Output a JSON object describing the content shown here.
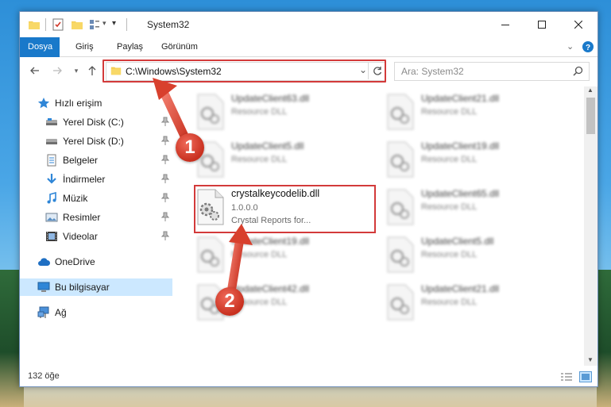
{
  "window": {
    "title": "System32"
  },
  "ribbon": {
    "tabs": [
      "Dosya",
      "Giriş",
      "Paylaş",
      "Görünüm"
    ]
  },
  "address": {
    "path": "C:\\Windows\\System32"
  },
  "search": {
    "placeholder": "Ara: System32"
  },
  "sidebar": {
    "items": [
      {
        "label": "Hızlı erişim",
        "icon": "star-icon",
        "pinned": false
      },
      {
        "label": "Yerel Disk (C:)",
        "icon": "drive-icon",
        "pinned": true
      },
      {
        "label": "Yerel Disk (D:)",
        "icon": "drive-icon",
        "pinned": true
      },
      {
        "label": "Belgeler",
        "icon": "documents-icon",
        "pinned": true
      },
      {
        "label": "İndirmeler",
        "icon": "download-icon",
        "pinned": true
      },
      {
        "label": "Müzik",
        "icon": "music-icon",
        "pinned": true
      },
      {
        "label": "Resimler",
        "icon": "pictures-icon",
        "pinned": true
      },
      {
        "label": "Videolar",
        "icon": "videos-icon",
        "pinned": true
      },
      {
        "label": "OneDrive",
        "icon": "cloud-icon",
        "pinned": false
      },
      {
        "label": "Bu bilgisayar",
        "icon": "computer-icon",
        "pinned": false,
        "selected": true
      },
      {
        "label": "Ağ",
        "icon": "network-icon",
        "pinned": false
      }
    ]
  },
  "files": [
    {
      "name": "UpdateClient63.dll",
      "sub": "Resource DLL"
    },
    {
      "name": "UpdateClient21.dll",
      "sub": "Resource DLL"
    },
    {
      "name": "UpdateClient5.dll",
      "sub": "Resource DLL"
    },
    {
      "name": "UpdateClient19.dll",
      "sub": "Resource DLL"
    },
    {
      "name": "crystalkeycodelib.dll",
      "version": "1.0.0.0",
      "sub": "Crystal Reports for..."
    },
    {
      "name": "UpdateClient65.dll",
      "sub": "Resource DLL"
    },
    {
      "name": "UpdateClient19.dll",
      "sub": "Resource DLL"
    },
    {
      "name": "UpdateClient5.dll",
      "sub": "Resource DLL"
    },
    {
      "name": "UpdateClient42.dll",
      "sub": "Resource DLL"
    },
    {
      "name": "UpdateClient21.dll",
      "sub": "Resource DLL"
    }
  ],
  "status": {
    "count": "132 öğe"
  },
  "annotations": {
    "step1": "1",
    "step2": "2"
  },
  "colors": {
    "accent": "#1979ca",
    "highlight": "#d33a3a",
    "selection": "#cce8ff"
  }
}
